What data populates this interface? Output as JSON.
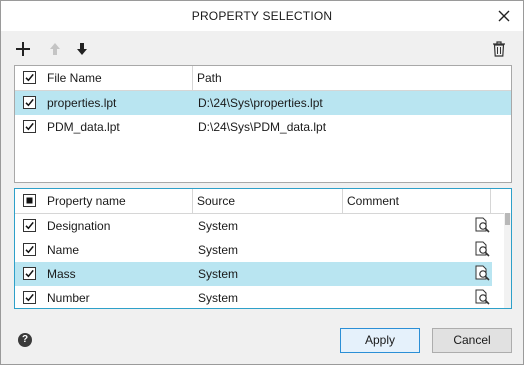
{
  "window": {
    "title": "PROPERTY SELECTION"
  },
  "files_table": {
    "headers": {
      "select_all": "",
      "name": "File Name",
      "path": "Path"
    },
    "rows": [
      {
        "checked": true,
        "name": "properties.lpt",
        "path": "D:\\24\\Sys\\properties.lpt",
        "selected": true
      },
      {
        "checked": true,
        "name": "PDM_data.lpt",
        "path": "D:\\24\\Sys\\PDM_data.lpt",
        "selected": false
      }
    ]
  },
  "properties_table": {
    "headers": {
      "name": "Property name",
      "source": "Source",
      "comment": "Comment"
    },
    "rows": [
      {
        "checked": true,
        "name": "Designation",
        "source": "System",
        "comment": "",
        "selected": false
      },
      {
        "checked": true,
        "name": "Name",
        "source": "System",
        "comment": "",
        "selected": false
      },
      {
        "checked": true,
        "name": "Mass",
        "source": "System",
        "comment": "",
        "selected": true
      },
      {
        "checked": true,
        "name": "Number",
        "source": "System",
        "comment": "",
        "selected": false
      }
    ]
  },
  "buttons": {
    "apply": "Apply",
    "cancel": "Cancel"
  },
  "help": {
    "symbol": "?"
  },
  "colors": {
    "selection": "#b9e5f1",
    "focus_border": "#2ea0c9",
    "primary_border": "#2b8fd6"
  }
}
